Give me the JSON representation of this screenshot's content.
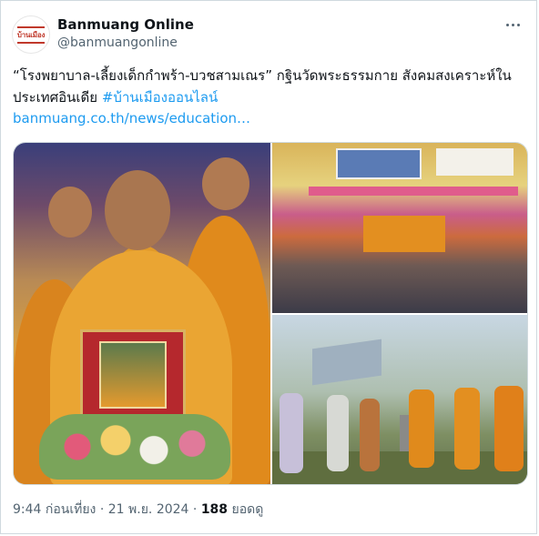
{
  "account": {
    "display_name": "Banmuang Online",
    "handle": "@banmuangonline",
    "avatar_text": "บ้านเมือง"
  },
  "tweet": {
    "text": "“โรงพยาบาล-เลี้ยงเด็กกำพร้า-บวชสามเณร” กฐินวัดพระธรรมกาย สังคมสงเคราะห์ในประเทศอินเดีย ",
    "hashtag": "#บ้านเมืองออนไลน์",
    "link": "banmuang.co.th/news/education…"
  },
  "meta": {
    "time": "9:44 ก่อนเที่ยง",
    "separator": " · ",
    "date": "21 พ.ย. 2024",
    "views_count": "188",
    "views_label": "ยอดดู"
  },
  "icons": {
    "more": "more-horizontal-icon"
  }
}
